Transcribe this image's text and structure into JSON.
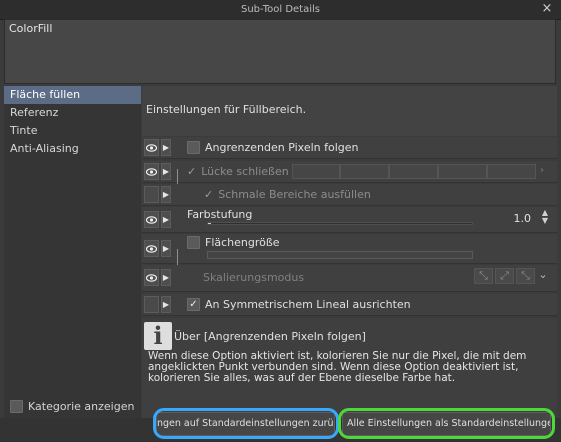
{
  "window": {
    "title": "Sub-Tool Details",
    "close_icon": "×"
  },
  "tool_name": "ColorFill",
  "sidebar": {
    "items": [
      {
        "label": "Fläche füllen",
        "selected": true
      },
      {
        "label": "Referenz",
        "selected": false
      },
      {
        "label": "Tinte",
        "selected": false
      },
      {
        "label": "Anti-Aliasing",
        "selected": false
      }
    ],
    "show_category_label": "Kategorie anzeigen",
    "show_category_checked": false
  },
  "section": {
    "title": "Einstellungen für Füllbereich."
  },
  "properties": {
    "follow_adjacent": {
      "label": "Angrenzenden Pixeln folgen",
      "checked": false
    },
    "close_gap": {
      "label": "Lücke schließen",
      "checked": true,
      "enabled": false
    },
    "fill_narrow": {
      "label": "Schmale Bereiche ausfüllen",
      "checked": true,
      "enabled": false
    },
    "color_tolerance": {
      "label": "Farbstufung",
      "value": "1.0",
      "fraction": 0.01
    },
    "area_size": {
      "label": "Flächengröße",
      "checked": false
    },
    "scale_mode": {
      "label": "Skalierungsmodus"
    },
    "symmetric_ruler": {
      "label": "An Symmetrischem Lineal ausrichten",
      "checked": true
    }
  },
  "help": {
    "icon": "info-icon",
    "title": "Über [Angrenzenden Pixeln folgen]",
    "text": "Wenn diese Option aktiviert ist, kolorieren Sie nur die Pixel, die mit dem angeklickten Punkt verbunden sind. Wenn diese Option deaktiviert ist, kolorieren Sie alles, was auf der Ebene dieselbe Farbe hat."
  },
  "buttons": {
    "reset_label": "ngen auf Standardeinstellungen zurücksetzen",
    "save_all_label": "Alle Einstellungen als Standardeinstellungen speiche"
  },
  "colors": {
    "highlight_blue": "#38a8ff",
    "highlight_green": "#4cd838",
    "selection": "#5c6b86"
  }
}
